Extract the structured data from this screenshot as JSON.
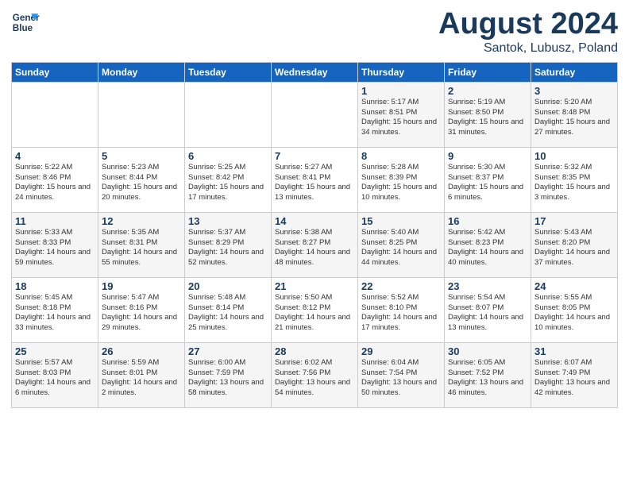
{
  "header": {
    "logo_line1": "General",
    "logo_line2": "Blue",
    "title": "August 2024",
    "subtitle": "Santok, Lubusz, Poland"
  },
  "weekdays": [
    "Sunday",
    "Monday",
    "Tuesday",
    "Wednesday",
    "Thursday",
    "Friday",
    "Saturday"
  ],
  "weeks": [
    [
      {
        "day": "",
        "text": ""
      },
      {
        "day": "",
        "text": ""
      },
      {
        "day": "",
        "text": ""
      },
      {
        "day": "",
        "text": ""
      },
      {
        "day": "1",
        "text": "Sunrise: 5:17 AM\nSunset: 8:51 PM\nDaylight: 15 hours\nand 34 minutes."
      },
      {
        "day": "2",
        "text": "Sunrise: 5:19 AM\nSunset: 8:50 PM\nDaylight: 15 hours\nand 31 minutes."
      },
      {
        "day": "3",
        "text": "Sunrise: 5:20 AM\nSunset: 8:48 PM\nDaylight: 15 hours\nand 27 minutes."
      }
    ],
    [
      {
        "day": "4",
        "text": "Sunrise: 5:22 AM\nSunset: 8:46 PM\nDaylight: 15 hours\nand 24 minutes."
      },
      {
        "day": "5",
        "text": "Sunrise: 5:23 AM\nSunset: 8:44 PM\nDaylight: 15 hours\nand 20 minutes."
      },
      {
        "day": "6",
        "text": "Sunrise: 5:25 AM\nSunset: 8:42 PM\nDaylight: 15 hours\nand 17 minutes."
      },
      {
        "day": "7",
        "text": "Sunrise: 5:27 AM\nSunset: 8:41 PM\nDaylight: 15 hours\nand 13 minutes."
      },
      {
        "day": "8",
        "text": "Sunrise: 5:28 AM\nSunset: 8:39 PM\nDaylight: 15 hours\nand 10 minutes."
      },
      {
        "day": "9",
        "text": "Sunrise: 5:30 AM\nSunset: 8:37 PM\nDaylight: 15 hours\nand 6 minutes."
      },
      {
        "day": "10",
        "text": "Sunrise: 5:32 AM\nSunset: 8:35 PM\nDaylight: 15 hours\nand 3 minutes."
      }
    ],
    [
      {
        "day": "11",
        "text": "Sunrise: 5:33 AM\nSunset: 8:33 PM\nDaylight: 14 hours\nand 59 minutes."
      },
      {
        "day": "12",
        "text": "Sunrise: 5:35 AM\nSunset: 8:31 PM\nDaylight: 14 hours\nand 55 minutes."
      },
      {
        "day": "13",
        "text": "Sunrise: 5:37 AM\nSunset: 8:29 PM\nDaylight: 14 hours\nand 52 minutes."
      },
      {
        "day": "14",
        "text": "Sunrise: 5:38 AM\nSunset: 8:27 PM\nDaylight: 14 hours\nand 48 minutes."
      },
      {
        "day": "15",
        "text": "Sunrise: 5:40 AM\nSunset: 8:25 PM\nDaylight: 14 hours\nand 44 minutes."
      },
      {
        "day": "16",
        "text": "Sunrise: 5:42 AM\nSunset: 8:23 PM\nDaylight: 14 hours\nand 40 minutes."
      },
      {
        "day": "17",
        "text": "Sunrise: 5:43 AM\nSunset: 8:20 PM\nDaylight: 14 hours\nand 37 minutes."
      }
    ],
    [
      {
        "day": "18",
        "text": "Sunrise: 5:45 AM\nSunset: 8:18 PM\nDaylight: 14 hours\nand 33 minutes."
      },
      {
        "day": "19",
        "text": "Sunrise: 5:47 AM\nSunset: 8:16 PM\nDaylight: 14 hours\nand 29 minutes."
      },
      {
        "day": "20",
        "text": "Sunrise: 5:48 AM\nSunset: 8:14 PM\nDaylight: 14 hours\nand 25 minutes."
      },
      {
        "day": "21",
        "text": "Sunrise: 5:50 AM\nSunset: 8:12 PM\nDaylight: 14 hours\nand 21 minutes."
      },
      {
        "day": "22",
        "text": "Sunrise: 5:52 AM\nSunset: 8:10 PM\nDaylight: 14 hours\nand 17 minutes."
      },
      {
        "day": "23",
        "text": "Sunrise: 5:54 AM\nSunset: 8:07 PM\nDaylight: 14 hours\nand 13 minutes."
      },
      {
        "day": "24",
        "text": "Sunrise: 5:55 AM\nSunset: 8:05 PM\nDaylight: 14 hours\nand 10 minutes."
      }
    ],
    [
      {
        "day": "25",
        "text": "Sunrise: 5:57 AM\nSunset: 8:03 PM\nDaylight: 14 hours\nand 6 minutes."
      },
      {
        "day": "26",
        "text": "Sunrise: 5:59 AM\nSunset: 8:01 PM\nDaylight: 14 hours\nand 2 minutes."
      },
      {
        "day": "27",
        "text": "Sunrise: 6:00 AM\nSunset: 7:59 PM\nDaylight: 13 hours\nand 58 minutes."
      },
      {
        "day": "28",
        "text": "Sunrise: 6:02 AM\nSunset: 7:56 PM\nDaylight: 13 hours\nand 54 minutes."
      },
      {
        "day": "29",
        "text": "Sunrise: 6:04 AM\nSunset: 7:54 PM\nDaylight: 13 hours\nand 50 minutes."
      },
      {
        "day": "30",
        "text": "Sunrise: 6:05 AM\nSunset: 7:52 PM\nDaylight: 13 hours\nand 46 minutes."
      },
      {
        "day": "31",
        "text": "Sunrise: 6:07 AM\nSunset: 7:49 PM\nDaylight: 13 hours\nand 42 minutes."
      }
    ]
  ]
}
